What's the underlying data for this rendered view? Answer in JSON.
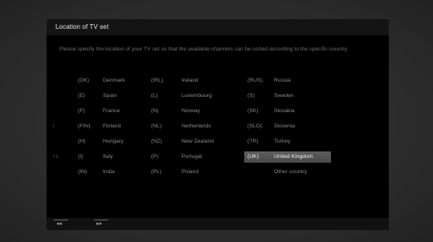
{
  "title": "Location of TV set",
  "instructions": "Please specify the location of your TV set so that the available channels can be sorted according to the specific country.",
  "columns": [
    [
      {
        "code": "(DK)",
        "name": "Denmark"
      },
      {
        "code": "(E)",
        "name": "Spain"
      },
      {
        "code": "(F)",
        "name": "France"
      },
      {
        "code": "(FIN)",
        "name": "Finland"
      },
      {
        "code": "(H)",
        "name": "Hungary"
      },
      {
        "code": "(I)",
        "name": "Italy"
      },
      {
        "code": "(IN)",
        "name": "India"
      }
    ],
    [
      {
        "code": "(IRL)",
        "name": "Ireland"
      },
      {
        "code": "(L)",
        "name": "Luxembourg"
      },
      {
        "code": "(N)",
        "name": "Norway"
      },
      {
        "code": "(NL)",
        "name": "Netherlands"
      },
      {
        "code": "(NZ)",
        "name": "New Zealand"
      },
      {
        "code": "(P)",
        "name": "Portugal"
      },
      {
        "code": "(PL)",
        "name": "Poland"
      }
    ],
    [
      {
        "code": "(RUS)",
        "name": "Russia"
      },
      {
        "code": "(S)",
        "name": "Sweden"
      },
      {
        "code": "(SK)",
        "name": "Slovakia"
      },
      {
        "code": "(SLO)",
        "name": "Slovenia"
      },
      {
        "code": "(TR)",
        "name": "Turkey"
      },
      {
        "code": "(UK)",
        "name": "United Kingdom",
        "selected": true
      },
      {
        "code": "",
        "name": "Other country"
      }
    ]
  ],
  "nav": {
    "prev_glyph": "◂◂",
    "next_glyph": "▸▸"
  },
  "edge_marks": {
    "left_row4": "I",
    "left_row6": "I:c"
  },
  "colors": {
    "selection": "#555555",
    "background": "#000000",
    "text": "#8a8a8a"
  }
}
